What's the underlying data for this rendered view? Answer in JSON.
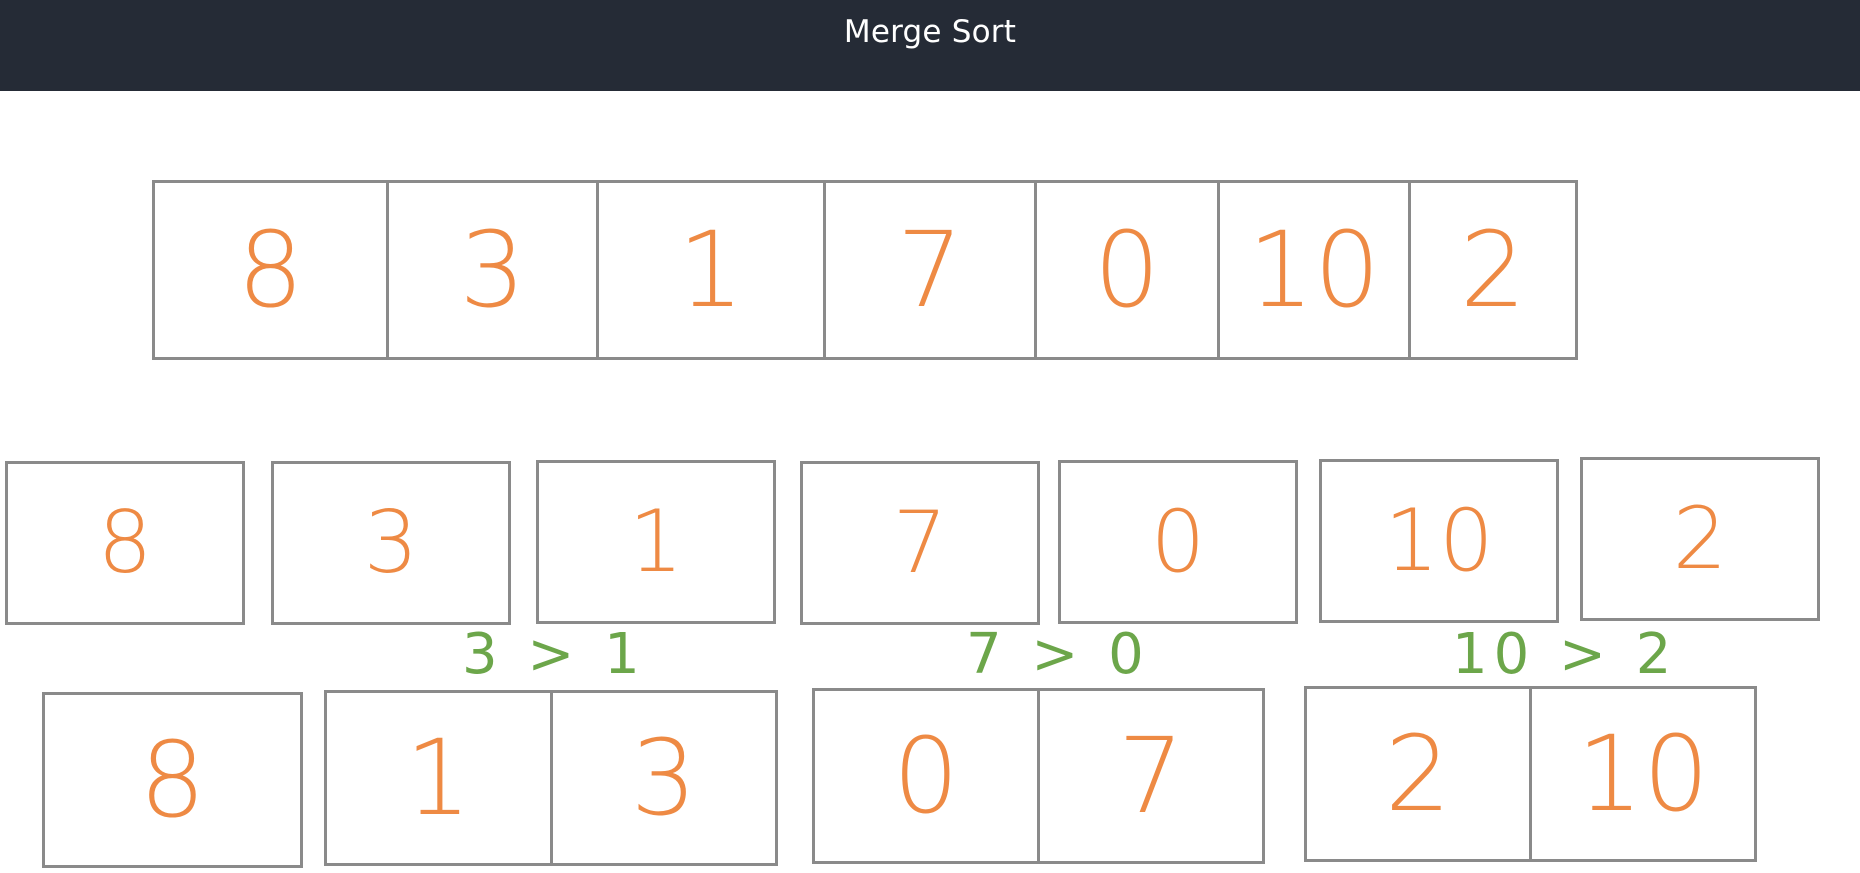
{
  "header": {
    "title": "Merge Sort"
  },
  "colors": {
    "header_bg": "#252b36",
    "box_border": "#8a8a8a",
    "number": "#ee8a44",
    "comparison": "#6ca64a"
  },
  "rows": {
    "original": [
      "8",
      "3",
      "1",
      "7",
      "0",
      "10",
      "2"
    ],
    "split": [
      "8",
      "3",
      "1",
      "7",
      "0",
      "10",
      "2"
    ],
    "comparisons": [
      "3 > 1",
      "7 > 0",
      "10 > 2"
    ],
    "merged_groups": [
      [
        "8"
      ],
      [
        "1",
        "3"
      ],
      [
        "0",
        "7"
      ],
      [
        "2",
        "10"
      ]
    ]
  }
}
